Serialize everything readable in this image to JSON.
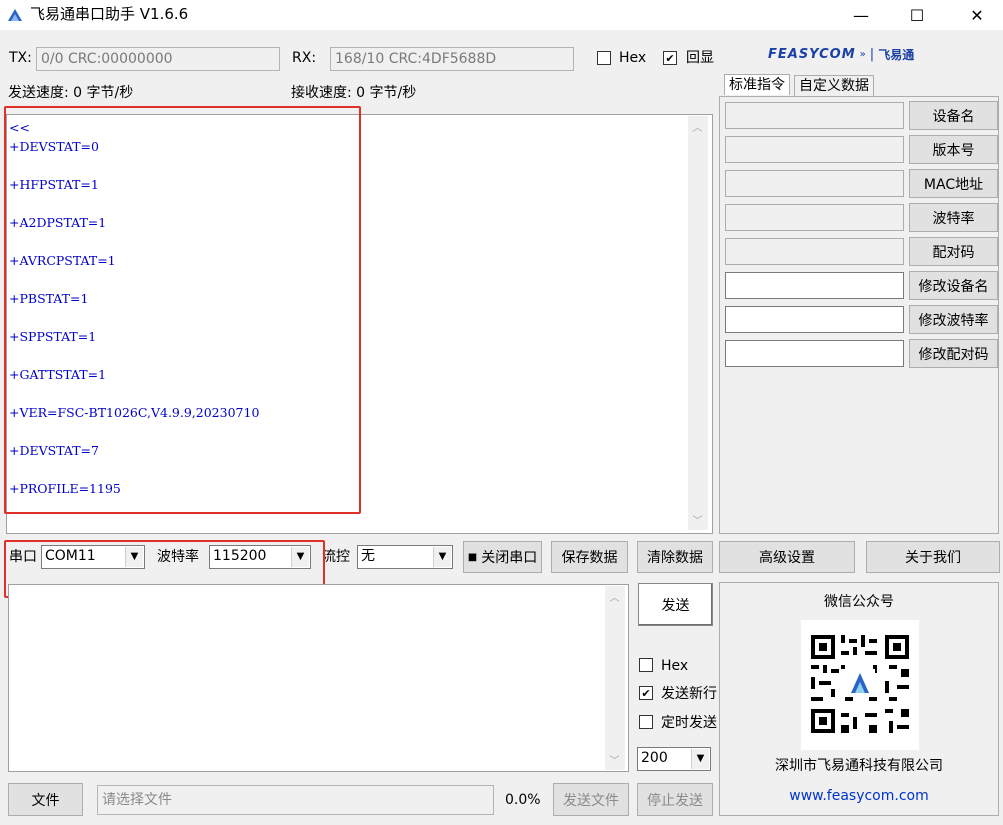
{
  "window": {
    "title": "飞易通串口助手 V1.6.6",
    "minimize_glyph": "—",
    "maximize_glyph": "☐",
    "close_glyph": "✕"
  },
  "status": {
    "tx_label": "TX:",
    "tx_value": "0/0 CRC:00000000",
    "rx_label": "RX:",
    "rx_value": "168/10 CRC:4DF5688D",
    "hex_label": "Hex",
    "hex_checked": false,
    "echo_label": "回显",
    "echo_checked": true,
    "send_speed": "发送速度: 0 字节/秒",
    "recv_speed": "接收速度: 0 字节/秒"
  },
  "logo": {
    "brand": "FEASYCOM",
    "separator": "|",
    "cn_brand": "飞易通"
  },
  "receive_lines": [
    "<<",
    "+DEVSTAT=0",
    "",
    "+HFPSTAT=1",
    "",
    "+A2DPSTAT=1",
    "",
    "+AVRCPSTAT=1",
    "",
    "+PBSTAT=1",
    "",
    "+SPPSTAT=1",
    "",
    "+GATTSTAT=1",
    "",
    "+VER=FSC-BT1026C,V4.9.9,20230710",
    "",
    "+DEVSTAT=7",
    "",
    "+PROFILE=1195"
  ],
  "tabs": [
    {
      "label": "标准指令",
      "active": true
    },
    {
      "label": "自定义数据",
      "active": false
    }
  ],
  "commands": [
    {
      "label": "设备名",
      "value": "",
      "editable": false
    },
    {
      "label": "版本号",
      "value": "",
      "editable": false
    },
    {
      "label": "MAC地址",
      "value": "",
      "editable": false
    },
    {
      "label": "波特率",
      "value": "",
      "editable": false
    },
    {
      "label": "配对码",
      "value": "",
      "editable": false
    },
    {
      "label": "修改设备名",
      "value": "",
      "editable": true
    },
    {
      "label": "修改波特率",
      "value": "",
      "editable": true
    },
    {
      "label": "修改配对码",
      "value": "",
      "editable": true
    }
  ],
  "serial": {
    "port_label": "串口",
    "port_value": "COM11",
    "baud_label": "波特率",
    "baud_value": "115200",
    "flow_label": "流控",
    "flow_value": "无",
    "close_port_label": "关闭串口",
    "save_data_label": "保存数据",
    "clear_data_label": "清除数据",
    "advanced_label": "高级设置",
    "about_label": "关于我们"
  },
  "send": {
    "send_label": "发送",
    "hex_label": "Hex",
    "hex_checked": false,
    "newline_label": "发送新行",
    "newline_checked": true,
    "timed_label": "定时发送",
    "timed_checked": false,
    "interval_value": "200",
    "text": ""
  },
  "wechat": {
    "title": "微信公众号",
    "company": "深圳市飞易通科技有限公司",
    "website": "www.feasycom.com"
  },
  "file": {
    "file_button": "文件",
    "placeholder": "请选择文件",
    "progress": "0.0%",
    "send_file_label": "发送文件",
    "stop_send_label": "停止发送"
  },
  "colors": {
    "receive_text": "#0000cc",
    "highlight_box": "#e0302a",
    "logo_blue": "#1a3fa6",
    "website_link": "#0033cc"
  }
}
